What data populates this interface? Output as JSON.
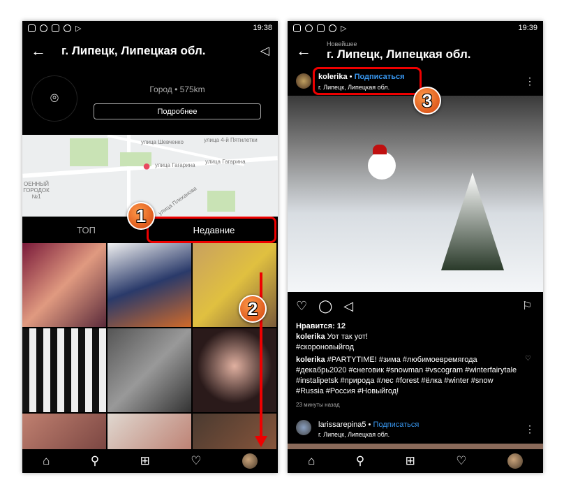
{
  "left": {
    "status": {
      "time": "19:38"
    },
    "header": {
      "title": "г. Липецк, Липецкая обл."
    },
    "info": {
      "meta": "Город • 575km",
      "details_button": "Подробнее"
    },
    "map": {
      "labels": [
        "улица Шевченко",
        "улица 4-й Пятилетки",
        "улица Гагарина",
        "улица Гагарина",
        "ОЕННЫЙ ГОРОДОК №1",
        "улица Плеханова"
      ]
    },
    "tabs": [
      {
        "label": "ТОП"
      },
      {
        "label": "Недавние",
        "active": true
      }
    ],
    "annotations": {
      "step1": "1",
      "step2": "2"
    }
  },
  "right": {
    "status": {
      "time": "19:39"
    },
    "header": {
      "subtitle": "Новейшее",
      "title": "г. Липецк, Липецкая обл."
    },
    "post": {
      "username": "kolerika",
      "follow": "Подписаться",
      "location": "г. Липецк, Липецкая обл.",
      "likes": "Нравится: 12",
      "caption_user": "kolerika",
      "caption": "Уот так уот!",
      "caption_tag": "#скороновыйгод",
      "comment_user": "kolerika",
      "comment": "#PARTYTIME! #зима #любимоевремягода #декабрь2020 #снеговик #snowman #vscogram #winterfairytale #instalipetsk #природа #лес #forest #ёлка #winter #snow #Russia #Россия #Новыйгод!",
      "time": "23 минуты назад"
    },
    "next_post": {
      "username": "larissarepina5",
      "follow": "Подписаться",
      "location": "г. Липецк, Липецкая обл."
    },
    "annotations": {
      "step3": "3"
    }
  },
  "colors": {
    "accent": "#3897f0",
    "annotation": "#e00000",
    "badge": "#e8601a"
  }
}
